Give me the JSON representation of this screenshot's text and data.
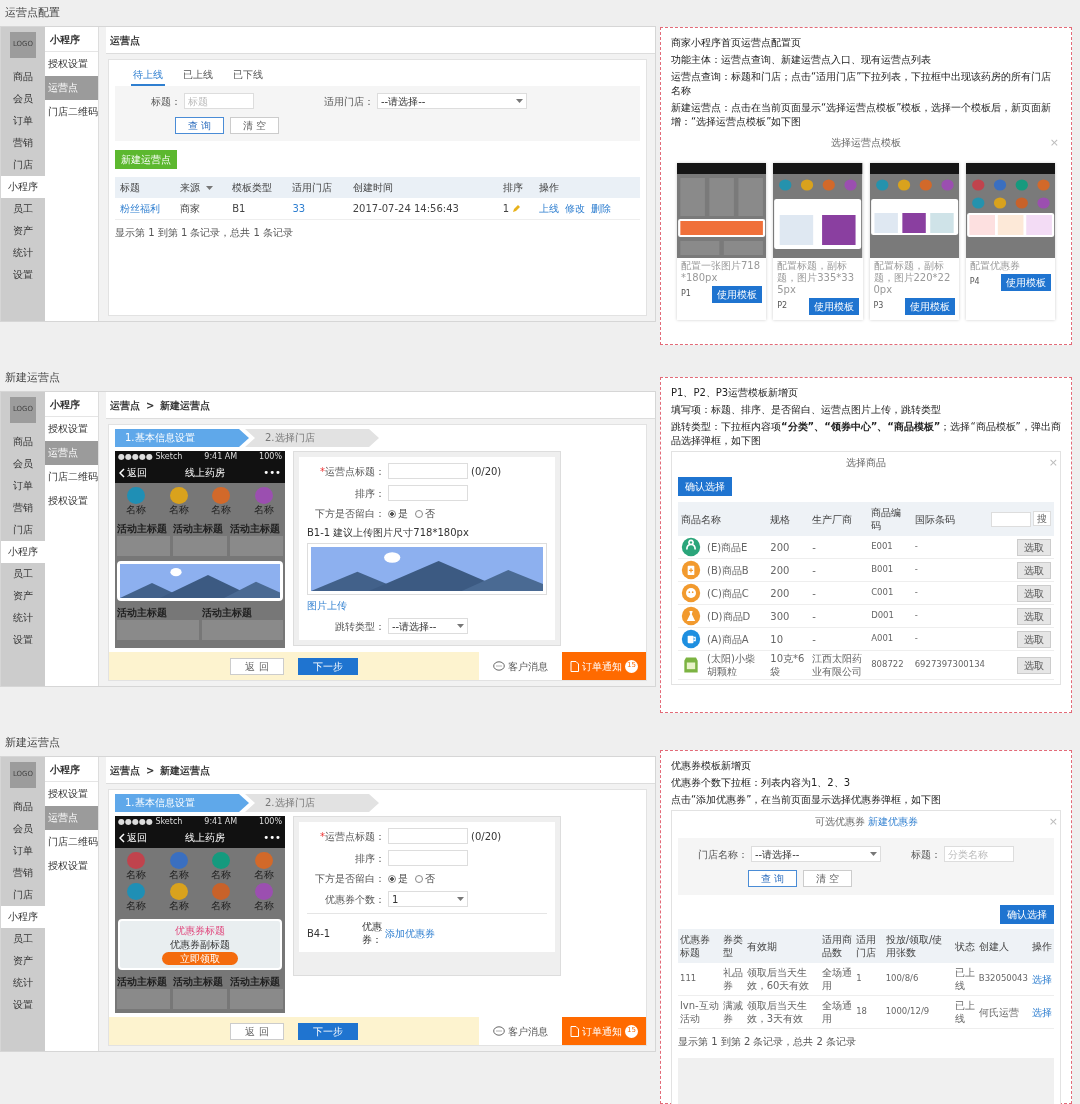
{
  "config_page": {
    "kind": "list",
    "caption": "运营点配置",
    "logo": "LOGO",
    "main_nav": [
      {
        "label": "商品",
        "selected": false
      },
      {
        "label": "会员",
        "selected": false
      },
      {
        "label": "订单",
        "selected": false
      },
      {
        "label": "营销",
        "selected": false
      },
      {
        "label": "门店",
        "selected": false
      },
      {
        "label": "小程序",
        "selected": true
      },
      {
        "label": "员工",
        "selected": false
      },
      {
        "label": "资产",
        "selected": false
      },
      {
        "label": "统计",
        "selected": false
      },
      {
        "label": "设置",
        "selected": false
      }
    ],
    "sub_nav": {
      "title": "小程序",
      "items": [
        {
          "label": "授权设置",
          "selected": false
        },
        {
          "label": "运营点",
          "selected": true
        },
        {
          "label": "门店二维码",
          "selected": false
        }
      ]
    },
    "header": {
      "items": [
        "运营点"
      ]
    },
    "tabs": [
      {
        "label": "待上线",
        "selected": true
      },
      {
        "label": "已上线",
        "selected": false
      },
      {
        "label": "已下线",
        "selected": false
      }
    ],
    "filters": [
      {
        "kind": "input",
        "label": "标题：",
        "placeholder": "标题"
      },
      {
        "kind": "select",
        "label": "适用门店：",
        "value": "--请选择--"
      }
    ],
    "buttons": [
      {
        "label": "查 询",
        "kind": "primary"
      },
      {
        "label": "清 空",
        "kind": "plain"
      }
    ],
    "new_button": "新建运营点",
    "table": {
      "columns": [
        {
          "label": "标题"
        },
        {
          "label": "来源",
          "sortable": true
        },
        {
          "label": "模板类型"
        },
        {
          "label": "适用门店"
        },
        {
          "label": "创建时间"
        },
        {
          "label": "排序"
        },
        {
          "label": "操作"
        }
      ],
      "rows": [
        {
          "title": "粉丝福利",
          "source": "商家",
          "template": "B1",
          "stores": "33",
          "created": "2017-07-24 14:56:43",
          "order": "1",
          "actions": [
            "上线",
            "修改",
            "删除"
          ]
        }
      ]
    },
    "pagination": "显示第 1 到第 1 条记录，总共 1 条记录"
  },
  "banner_page": {
    "kind": "wizard",
    "caption": "新建运营点",
    "logo": "LOGO",
    "main_nav": [
      {
        "label": "商品",
        "selected": false
      },
      {
        "label": "会员",
        "selected": false
      },
      {
        "label": "订单",
        "selected": false
      },
      {
        "label": "营销",
        "selected": false
      },
      {
        "label": "门店",
        "selected": false
      },
      {
        "label": "小程序",
        "selected": true
      },
      {
        "label": "员工",
        "selected": false
      },
      {
        "label": "资产",
        "selected": false
      },
      {
        "label": "统计",
        "selected": false
      },
      {
        "label": "设置",
        "selected": false
      }
    ],
    "sub_nav": {
      "title": "小程序",
      "items": [
        {
          "label": "授权设置",
          "selected": false
        },
        {
          "label": "运营点",
          "selected": true
        },
        {
          "label": "门店二维码",
          "selected": false
        },
        {
          "label": "授权设置",
          "selected": false
        }
      ]
    },
    "header": {
      "items": [
        "运营点",
        "新建运营点"
      ],
      "separator": ">"
    },
    "steps": [
      {
        "label": "1.基本信息设置",
        "selected": true
      },
      {
        "label": "2.选择门店",
        "selected": false
      }
    ],
    "phone": {
      "carrier": "●●●●● Sketch",
      "time": "9:41 AM",
      "battery": "100%",
      "back": "返回",
      "title": "线上药房",
      "more": "•••",
      "blocks": [
        {
          "kind": "icons",
          "items": [
            {
              "label": "名称",
              "color": "#1f8fb5"
            },
            {
              "label": "名称",
              "color": "#d9a21d"
            },
            {
              "label": "名称",
              "color": "#d2692a"
            },
            {
              "label": "名称",
              "color": "#9b4fb0"
            }
          ]
        },
        {
          "kind": "tiles",
          "items": [
            "活动主标题",
            "活动主标题",
            "活动主标题"
          ]
        },
        {
          "kind": "banner",
          "selected": true
        },
        {
          "kind": "tiles",
          "items": [
            "活动主标题",
            "活动主标题"
          ]
        }
      ]
    },
    "form": [
      {
        "kind": "input",
        "mark": "*",
        "label": "运营点标题：",
        "counter": "(0/20)"
      },
      {
        "kind": "input",
        "label": "排序："
      },
      {
        "kind": "radio",
        "label": "下方是否留白：",
        "options": [
          {
            "label": "是",
            "selected": true
          },
          {
            "label": "否",
            "selected": false
          }
        ]
      },
      {
        "kind": "upload",
        "hint": "B1-1 建议上传图片尺寸718*180px",
        "link": "图片上传"
      },
      {
        "kind": "select",
        "label": "跳转类型：",
        "value": "--请选择--"
      }
    ],
    "footer": {
      "buttons": [
        {
          "label": "返 回",
          "kind": "plain"
        },
        {
          "label": "下一步",
          "kind": "primary"
        }
      ],
      "message": "客户消息",
      "notice": "订单通知",
      "notice_count": "15"
    }
  },
  "coupon_page": {
    "kind": "wizard",
    "caption": "新建运营点",
    "logo": "LOGO",
    "main_nav": [
      {
        "label": "商品",
        "selected": false
      },
      {
        "label": "会员",
        "selected": false
      },
      {
        "label": "订单",
        "selected": false
      },
      {
        "label": "营销",
        "selected": false
      },
      {
        "label": "门店",
        "selected": false
      },
      {
        "label": "小程序",
        "selected": true
      },
      {
        "label": "员工",
        "selected": false
      },
      {
        "label": "资产",
        "selected": false
      },
      {
        "label": "统计",
        "selected": false
      },
      {
        "label": "设置",
        "selected": false
      }
    ],
    "sub_nav": {
      "title": "小程序",
      "items": [
        {
          "label": "授权设置",
          "selected": false
        },
        {
          "label": "运营点",
          "selected": true
        },
        {
          "label": "门店二维码",
          "selected": false
        },
        {
          "label": "授权设置",
          "selected": false
        }
      ]
    },
    "header": {
      "items": [
        "运营点",
        "新建运营点"
      ],
      "separator": ">"
    },
    "steps": [
      {
        "label": "1.基本信息设置",
        "selected": true
      },
      {
        "label": "2.选择门店",
        "selected": false
      }
    ],
    "phone": {
      "carrier": "●●●●● Sketch",
      "time": "9:41 AM",
      "battery": "100%",
      "back": "返回",
      "title": "线上药房",
      "more": "•••",
      "blocks": [
        {
          "kind": "icons",
          "items": [
            {
              "label": "名称",
              "color": "#c0434d"
            },
            {
              "label": "名称",
              "color": "#3a6fc0"
            },
            {
              "label": "名称",
              "color": "#159a7e"
            },
            {
              "label": "名称",
              "color": "#d2692a"
            },
            {
              "label": "名称",
              "color": "#1f8fb5"
            },
            {
              "label": "名称",
              "color": "#d9a21d"
            },
            {
              "label": "名称",
              "color": "#c8622a"
            },
            {
              "label": "名称",
              "color": "#9b4fb0"
            }
          ]
        },
        {
          "kind": "coupon",
          "selected": true,
          "title": "优惠券标题",
          "subtitle": "优惠券副标题",
          "button": "立即领取"
        },
        {
          "kind": "tiles",
          "items": [
            "活动主标题",
            "活动主标题",
            "活动主标题"
          ]
        }
      ]
    },
    "form": [
      {
        "kind": "input",
        "mark": "*",
        "label": "运营点标题：",
        "counter": "(0/20)"
      },
      {
        "kind": "input",
        "label": "排序："
      },
      {
        "kind": "radio",
        "label": "下方是否留白：",
        "options": [
          {
            "label": "是",
            "selected": true
          },
          {
            "label": "否",
            "selected": false
          }
        ]
      },
      {
        "kind": "select",
        "label": "优惠券个数：",
        "value": "1"
      },
      {
        "kind": "link",
        "code": "B4-1",
        "label": "优惠券：",
        "link": "添加优惠券"
      }
    ],
    "footer": {
      "buttons": [
        {
          "label": "返 回",
          "kind": "plain"
        },
        {
          "label": "下一步",
          "kind": "primary"
        }
      ],
      "message": "客户消息",
      "notice": "订单通知",
      "notice_count": "15"
    }
  },
  "template_note": {
    "paragraphs": [
      "商家小程序首页运营点配置页",
      "功能主体：运营点查询、新建运营点入口、现有运营点列表",
      "运营点查询：标题和门店；点击“适用门店”下拉列表，下拉框中出现该药房的所有门店名称",
      "新建运营点：点击在当前页面显示“选择运营点模板”模板，选择一个模板后，新页面新增：“选择运营点模板”如下图"
    ],
    "dialog": {
      "kind": "templates",
      "title": "选择运营点模板",
      "close": "×",
      "cards": [
        {
          "kind": "banner",
          "caption": "配置一张图片718*180px",
          "code": "P1",
          "button": "使用模板"
        },
        {
          "kind": "double",
          "caption": "配置标题，副标题，图片335*335px",
          "code": "P2",
          "button": "使用模板"
        },
        {
          "kind": "triple",
          "caption": "配置标题，副标题，图片220*220px",
          "code": "P3",
          "button": "使用模板"
        },
        {
          "kind": "coupons",
          "caption": "配置优惠券",
          "code": "P4",
          "button": "使用模板"
        }
      ]
    }
  },
  "banner_note": {
    "paragraphs": [
      "P1、P2、P3运营模板新增页",
      "填写项：标题、排序、是否留白、运营点图片上传，跳转类型",
      "跳转类型：下拉框内容项**“分类”、“领券中心”、“商品模板”**；选择“商品模板”，弹出商品选择弹框，如下图"
    ],
    "dialog": {
      "kind": "products",
      "title": "选择商品",
      "close": "×",
      "confirm": "确认选择",
      "search_button": "搜",
      "columns": [
        "商品名称",
        "规格",
        "生产厂商",
        "商品编码",
        "国际条码"
      ],
      "rows": [
        {
          "color": "#2aa57a",
          "name": "(E)商品E",
          "spec": "200",
          "maker": "-",
          "code": "E001",
          "barcode": "-",
          "action": "选取"
        },
        {
          "color": "#f29a2e",
          "name": "(B)商品B",
          "spec": "200",
          "maker": "-",
          "code": "B001",
          "barcode": "-",
          "action": "选取"
        },
        {
          "color": "#f29a2e",
          "name": "(C)商品C",
          "spec": "200",
          "maker": "-",
          "code": "C001",
          "barcode": "-",
          "action": "选取"
        },
        {
          "color": "#f29a2e",
          "name": "(D)商品D",
          "spec": "300",
          "maker": "-",
          "code": "D001",
          "barcode": "-",
          "action": "选取"
        },
        {
          "color": "#1e8fe0",
          "name": "(A)商品A",
          "spec": "10",
          "maker": "-",
          "code": "A001",
          "barcode": "-",
          "action": "选取"
        },
        {
          "color": "#7cb342",
          "name": "(太阳)小柴胡颗粒",
          "spec": "10克*6袋",
          "maker": "江西太阳药业有限公司",
          "code": "808722",
          "barcode": "6927397300134",
          "action": "选取"
        }
      ]
    }
  },
  "coupon_note": {
    "paragraphs": [
      "优惠券模板新增页",
      "优惠券个数下拉框：列表内容为1、2、3",
      "点击“添加优惠券”，在当前页面显示选择优惠券弹框，如下图"
    ],
    "dialog": {
      "kind": "coupons",
      "title": "可选优惠券",
      "title_link": "新建优惠券",
      "close": "×",
      "filters": [
        {
          "kind": "select",
          "label": "门店名称：",
          "value": "--请选择--"
        },
        {
          "kind": "input",
          "label": "标题：",
          "placeholder": "分类名称"
        }
      ],
      "buttons": [
        {
          "label": "查 询",
          "kind": "primary"
        },
        {
          "label": "清 空",
          "kind": "plain"
        }
      ],
      "confirm": "确认选择",
      "columns": [
        "优惠券标题",
        "券类型",
        "有效期",
        "适用商品数",
        "适用门店",
        "投放/领取/使用张数",
        "状态",
        "创建人",
        "操作"
      ],
      "rows": [
        [
          "111",
          "礼品券",
          "领取后当天生效，60天有效",
          "全场通用",
          "1",
          "100/8/6",
          "已上线",
          "B32050043",
          "选择"
        ],
        [
          "lvn-互动活动",
          "满减券",
          "领取后当天生效，3天有效",
          "全场通用",
          "18",
          "1000/12/9",
          "已上线",
          "何氏运营",
          "选择"
        ]
      ],
      "pagination": "显示第 1 到第 2 条记录，总共 2 条记录"
    }
  }
}
